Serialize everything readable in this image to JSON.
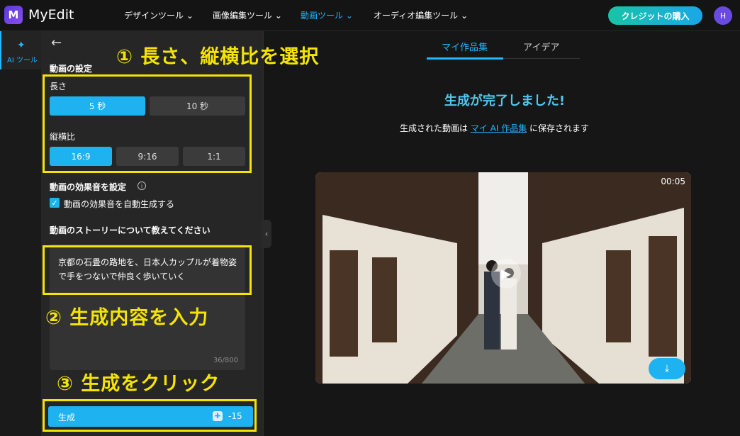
{
  "header": {
    "logo_glyph": "M",
    "brand": "MyEdit",
    "nav": [
      {
        "label": "デザインツール ⌄"
      },
      {
        "label": "画像編集ツール ⌄"
      },
      {
        "label": "動画ツール ⌄"
      },
      {
        "label": "オーディオ編集ツール ⌄"
      }
    ],
    "active_nav": "動画ツール",
    "buy_label": "クレジットの購入",
    "avatar_initial": "H"
  },
  "rail": {
    "label": "AI ツール",
    "icon": "magic-wand-icon"
  },
  "panel": {
    "video_settings_title": "動画の設定",
    "length_label": "長さ",
    "length_options": [
      "5 秒",
      "10 秒"
    ],
    "length_selected": "5 秒",
    "ratio_label": "縦横比",
    "ratio_options": [
      "16:9",
      "9:16",
      "1:1"
    ],
    "ratio_selected": "16:9",
    "sound_title": "動画の効果音を設定",
    "sound_checkbox_label": "動画の効果音を自動生成する",
    "sound_checked": true,
    "story_title": "動画のストーリーについて教えてください",
    "story_text": "京都の石畳の路地を、日本人カップルが着物姿で手をつないで仲良く歩いていく",
    "story_counter": "36/800",
    "generate_label": "生成",
    "credit_cost": "-15"
  },
  "annotations": {
    "step1": "① 長さ、縦横比を選択",
    "step2": "② 生成内容を入力",
    "step3": "③ 生成をクリック",
    "color": "#f5e400"
  },
  "main": {
    "tabs": [
      "マイ作品集",
      "アイデア"
    ],
    "active_tab": "マイ作品集",
    "done_title": "生成が完了しました!",
    "saved_prefix": "生成された動画は ",
    "saved_link": "マイ AI 作品集",
    "saved_suffix": " に保存されます",
    "video_duration": "00:05"
  },
  "colors": {
    "accent": "#1fb7ff",
    "highlight": "#f5e400"
  }
}
